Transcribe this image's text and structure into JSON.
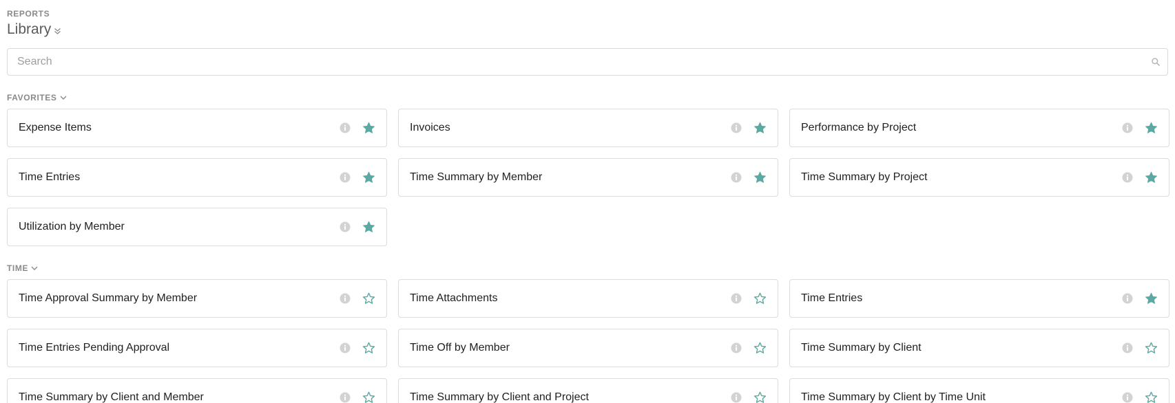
{
  "header": {
    "overline": "REPORTS",
    "title": "Library"
  },
  "search": {
    "placeholder": "Search"
  },
  "colors": {
    "accent": "#5aa9a2",
    "muted": "#c4c4c4"
  },
  "favorites": {
    "heading": "FAVORITES",
    "cards": [
      {
        "label": "Expense Items",
        "starred": true
      },
      {
        "label": "Invoices",
        "starred": true
      },
      {
        "label": "Performance by Project",
        "starred": true
      },
      {
        "label": "Time Entries",
        "starred": true
      },
      {
        "label": "Time Summary by Member",
        "starred": true
      },
      {
        "label": "Time Summary by Project",
        "starred": true
      },
      {
        "label": "Utilization by Member",
        "starred": true
      }
    ]
  },
  "time": {
    "heading": "TIME",
    "cards": [
      {
        "label": "Time Approval Summary by Member",
        "starred": false
      },
      {
        "label": "Time Attachments",
        "starred": false
      },
      {
        "label": "Time Entries",
        "starred": true
      },
      {
        "label": "Time Entries Pending Approval",
        "starred": false
      },
      {
        "label": "Time Off by Member",
        "starred": false
      },
      {
        "label": "Time Summary by Client",
        "starred": false
      },
      {
        "label": "Time Summary by Client and Member",
        "starred": false
      },
      {
        "label": "Time Summary by Client and Project",
        "starred": false
      },
      {
        "label": "Time Summary by Client by Time Unit",
        "starred": false
      }
    ]
  }
}
